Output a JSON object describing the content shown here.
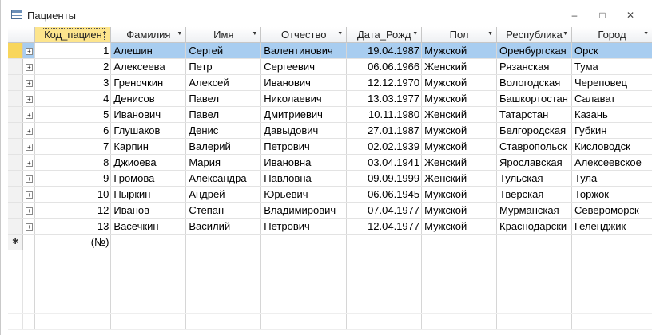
{
  "window": {
    "title": "Пациенты"
  },
  "columns": [
    "Код_пациен",
    "Фамилия",
    "Имя",
    "Отчество",
    "Дата_Рожд",
    "Пол",
    "Республика",
    "Город"
  ],
  "rows": [
    {
      "id": "1",
      "last": "Алешин",
      "first": "Сергей",
      "middle": "Валентинович",
      "dob": "19.04.1987",
      "sex": "Мужской",
      "region": "Оренбургская",
      "city": "Орск"
    },
    {
      "id": "2",
      "last": "Алексеева",
      "first": "Петр",
      "middle": "Сергеевич",
      "dob": "06.06.1966",
      "sex": "Женский",
      "region": "Рязанская",
      "city": "Тума"
    },
    {
      "id": "3",
      "last": "Греночкин",
      "first": "Алексей",
      "middle": "Иванович",
      "dob": "12.12.1970",
      "sex": "Мужской",
      "region": "Вологодская",
      "city": "Череповец"
    },
    {
      "id": "4",
      "last": "Денисов",
      "first": "Павел",
      "middle": "Николаевич",
      "dob": "13.03.1977",
      "sex": "Мужской",
      "region": "Башкортостан",
      "city": "Салават"
    },
    {
      "id": "5",
      "last": "Иванович",
      "first": "Павел",
      "middle": "Дмитриевич",
      "dob": "10.11.1980",
      "sex": "Женский",
      "region": "Татарстан",
      "city": "Казань"
    },
    {
      "id": "6",
      "last": "Глушаков",
      "first": "Денис",
      "middle": "Давыдович",
      "dob": "27.01.1987",
      "sex": "Мужской",
      "region": "Белгородская",
      "city": "Губкин"
    },
    {
      "id": "7",
      "last": "Карпин",
      "first": "Валерий",
      "middle": "Петрович",
      "dob": "02.02.1939",
      "sex": "Мужской",
      "region": "Ставропольск",
      "city": "Кисловодск"
    },
    {
      "id": "8",
      "last": "Джиоева",
      "first": "Мария",
      "middle": "Ивановна",
      "dob": "03.04.1941",
      "sex": "Женский",
      "region": "Ярославская",
      "city": "Алексеевское"
    },
    {
      "id": "9",
      "last": "Громова",
      "first": "Александра",
      "middle": "Павловна",
      "dob": "09.09.1999",
      "sex": "Женский",
      "region": "Тульская",
      "city": "Тула"
    },
    {
      "id": "10",
      "last": "Пыркин",
      "first": "Андрей",
      "middle": "Юрьевич",
      "dob": "06.06.1945",
      "sex": "Мужской",
      "region": "Тверская",
      "city": "Торжок"
    },
    {
      "id": "12",
      "last": "Иванов",
      "first": "Степан",
      "middle": "Владимирович",
      "dob": "07.04.1977",
      "sex": "Мужской",
      "region": "Мурманская",
      "city": "Североморск"
    },
    {
      "id": "13",
      "last": "Васечкин",
      "first": "Василий",
      "middle": "Петрович",
      "dob": "12.04.1977",
      "sex": "Мужской",
      "region": "Краснодарски",
      "city": "Геленджик"
    }
  ],
  "new_row": {
    "marker": "✱",
    "id_placeholder": "(№)"
  },
  "expand_glyph": "+",
  "colors": {
    "selected_row": "#a8cdf0",
    "current_marker": "#f8d65c",
    "active_header": "#fde58d"
  }
}
